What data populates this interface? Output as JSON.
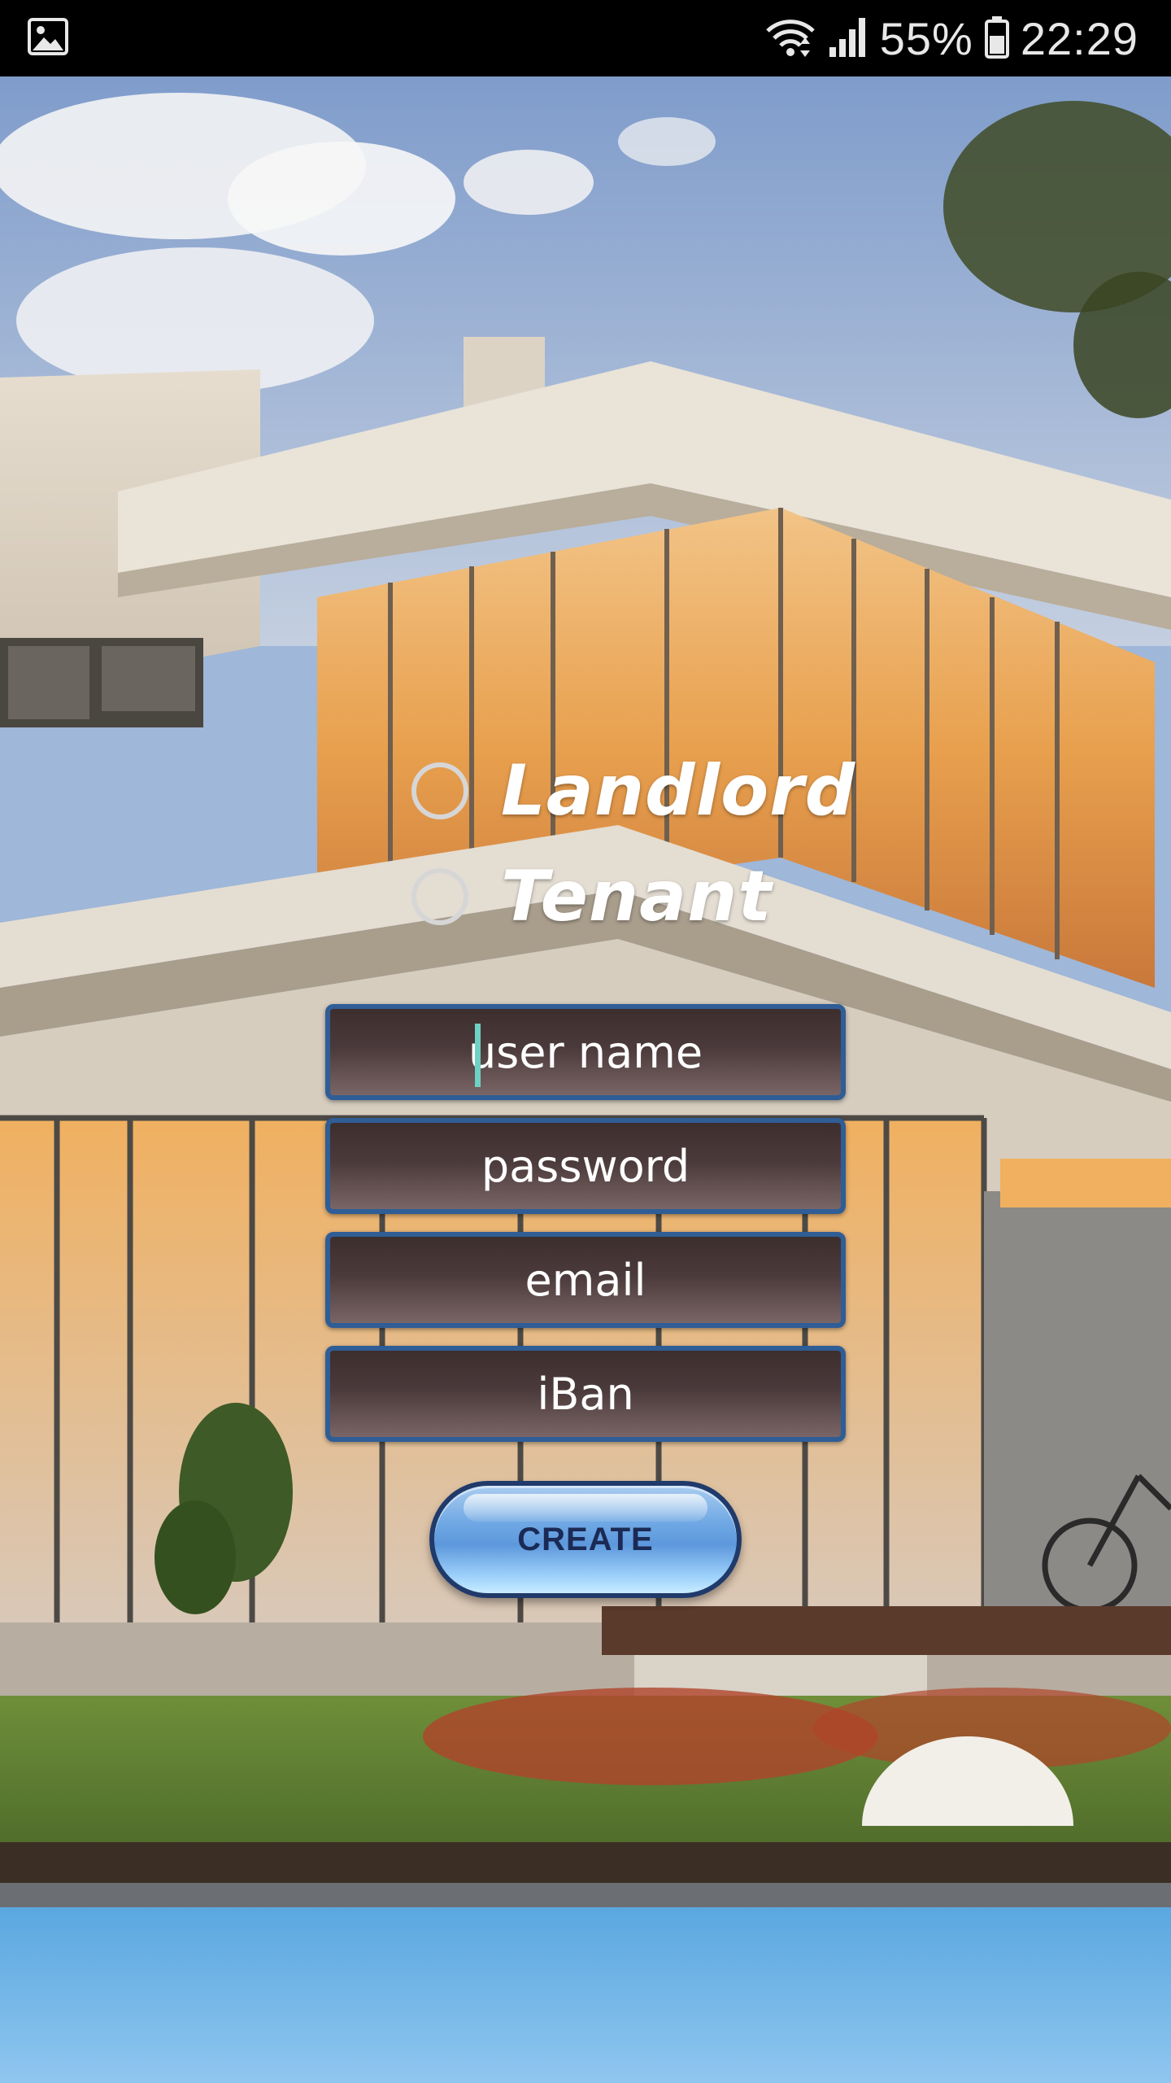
{
  "status_bar": {
    "battery_percent": "55%",
    "time": "22:29",
    "icons": [
      "gallery-notification-icon",
      "wifi-icon",
      "signal-icon",
      "battery-icon"
    ]
  },
  "background": {
    "description_icon": "house-photo-background"
  },
  "role_options": [
    {
      "label": "Landlord",
      "selected": false
    },
    {
      "label": "Tenant",
      "selected": false
    }
  ],
  "form": {
    "username": {
      "placeholder": "user name",
      "value": ""
    },
    "password": {
      "placeholder": "password",
      "value": ""
    },
    "email": {
      "placeholder": "email",
      "value": ""
    },
    "iban": {
      "placeholder": "iBan",
      "value": ""
    }
  },
  "create_button": {
    "label": "CREATE"
  },
  "colors": {
    "field_border": "#2f5d96",
    "button_text": "#1b2a55",
    "cursor": "#6fd0c4"
  }
}
